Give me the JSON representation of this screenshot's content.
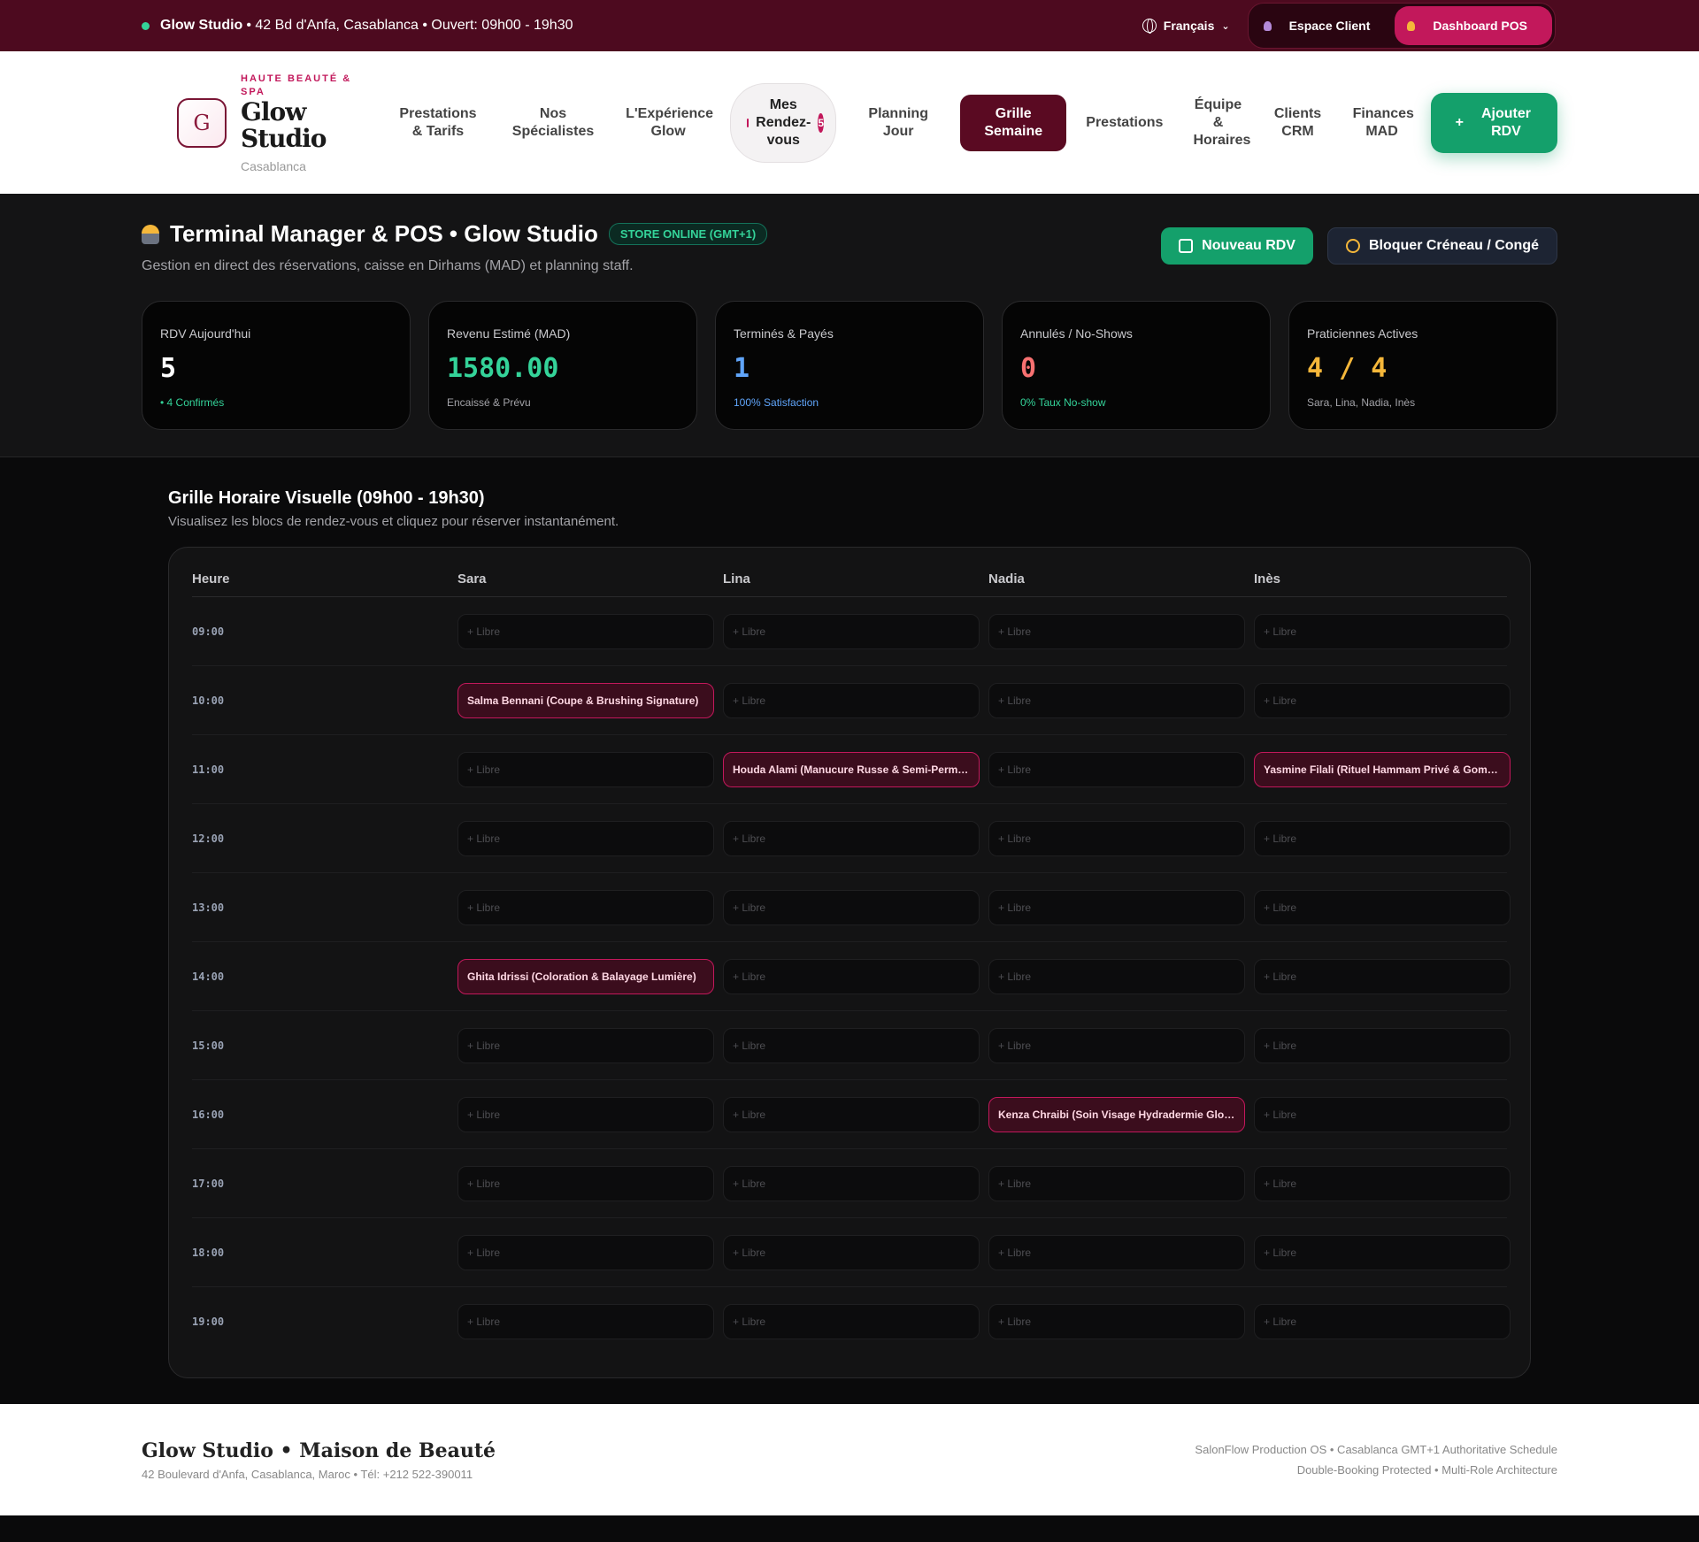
{
  "topbar": {
    "brand": "Glow Studio",
    "info": "• 42 Bd d'Anfa, Casablanca • Ouvert: 09h00 - 19h30",
    "language": "Français",
    "client_label": "Espace Client",
    "pos_label": "Dashboard POS",
    "status_color": "#34d399"
  },
  "header": {
    "logo_letter": "G",
    "tagline": "HAUTE BEAUTÉ & SPA",
    "name_line1": "Glow",
    "name_line2": "Studio",
    "city": "Casablanca",
    "nav": [
      "Prestations & Tarifs",
      "Nos Spécialistes",
      "L'Expérience Glow",
      "Mes Rendez-vous",
      "Planning Jour",
      "Grille Semaine",
      "Prestations",
      "Équipe & Horaires",
      "Clients CRM",
      "Finances MAD"
    ],
    "nav_badge": "5",
    "cta": "Ajouter RDV",
    "cta_icon": "+"
  },
  "dashboard": {
    "icon": "manager-icon",
    "title": "Terminal Manager & POS • Glow Studio",
    "store_status": "STORE ONLINE (GMT+1)",
    "subtitle": "Gestion en direct des réservations, caisse en Dirhams (MAD) et planning staff.",
    "new_button": "Nouveau RDV",
    "block_button": "Bloquer Créneau / Congé",
    "stats": [
      {
        "label": "RDV Aujourd'hui",
        "value": "5",
        "sub": "• 4 Confirmés",
        "value_color": "#ffffff",
        "sub_color": "#34d399"
      },
      {
        "label": "Revenu Estimé (MAD)",
        "value": "1580.00",
        "sub": "Encaissé & Prévu",
        "value_color": "#34d399",
        "sub_color": "#a3a3a8"
      },
      {
        "label": "Terminés & Payés",
        "value": "1",
        "sub": "100% Satisfaction",
        "value_color": "#60a5fa",
        "sub_color": "#60a5fa"
      },
      {
        "label": "Annulés / No-Shows",
        "value": "0",
        "sub": "0% Taux No-show",
        "value_color": "#f87171",
        "sub_color": "#34d399"
      },
      {
        "label": "Praticiennes Actives",
        "value": "4 / 4",
        "sub": "Sara, Lina, Nadia, Inès",
        "value_color": "#f5b73a",
        "sub_color": "#a3a3a8"
      }
    ]
  },
  "grid": {
    "title": "Grille Horaire Visuelle (09h00 - 19h30)",
    "subtitle": "Visualisez les blocs de rendez-vous et cliquez pour réserver instantanément.",
    "columns": [
      "Heure",
      "Sara",
      "Lina",
      "Nadia",
      "Inès"
    ],
    "free_label": "+ Libre",
    "rows": [
      {
        "time": "09:00",
        "slots": [
          "",
          "",
          "",
          ""
        ]
      },
      {
        "time": "10:00",
        "slots": [
          "Salma Bennani (Coupe & Brushing Signature)",
          "",
          "",
          ""
        ]
      },
      {
        "time": "11:00",
        "slots": [
          "",
          "Houda Alami (Manucure Russe & Semi-Permanent)",
          "",
          "Yasmine Filali (Rituel Hammam Privé & Gommage)"
        ]
      },
      {
        "time": "12:00",
        "slots": [
          "",
          "",
          "",
          ""
        ]
      },
      {
        "time": "13:00",
        "slots": [
          "",
          "",
          "",
          ""
        ]
      },
      {
        "time": "14:00",
        "slots": [
          "Ghita Idrissi (Coloration & Balayage Lumière)",
          "",
          "",
          ""
        ]
      },
      {
        "time": "15:00",
        "slots": [
          "",
          "",
          "",
          ""
        ]
      },
      {
        "time": "16:00",
        "slots": [
          "",
          "",
          "Kenza Chraibi (Soin Visage Hydradermie Glow)",
          ""
        ]
      },
      {
        "time": "17:00",
        "slots": [
          "",
          "",
          "",
          ""
        ]
      },
      {
        "time": "18:00",
        "slots": [
          "",
          "",
          "",
          ""
        ]
      },
      {
        "time": "19:00",
        "slots": [
          "",
          "",
          "",
          ""
        ]
      }
    ]
  },
  "footer": {
    "brand": "Glow Studio • Maison de Beauté",
    "address": "42 Boulevard d'Anfa, Casablanca, Maroc • Tél: +212 522-390011",
    "line1": "SalonFlow Production OS • Casablanca GMT+1 Authoritative Schedule",
    "line2": "Double-Booking Protected • Multi-Role Architecture"
  }
}
